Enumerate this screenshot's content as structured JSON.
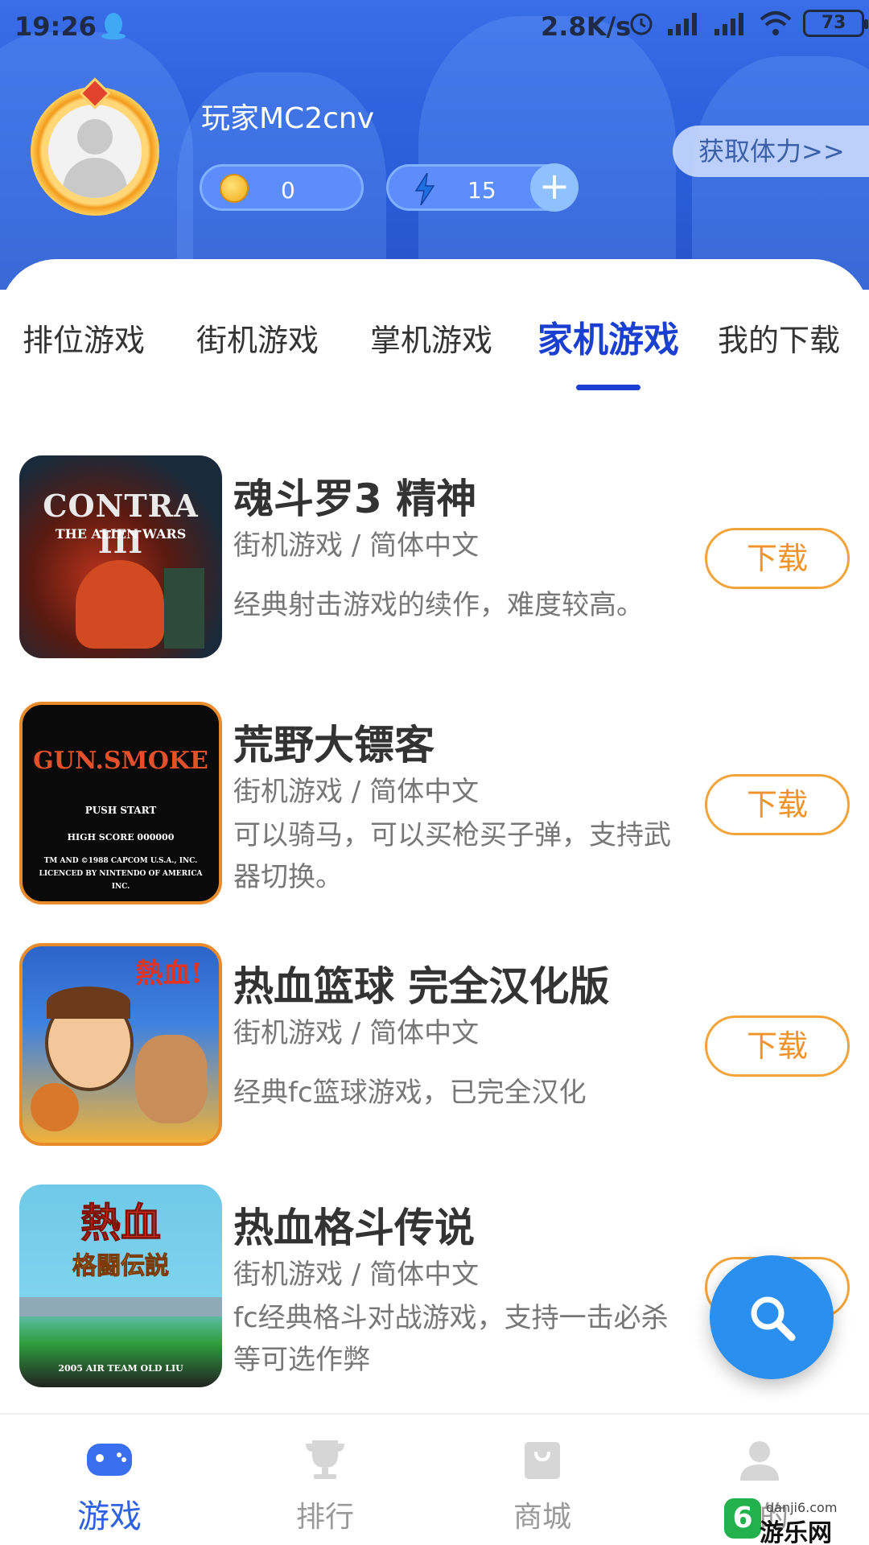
{
  "status_bar": {
    "time": "19:26",
    "speed": "2.8K/s",
    "battery": "73"
  },
  "profile": {
    "username": "玩家MC2cnv",
    "coins": "0",
    "energy": "15",
    "get_energy_label": "获取体力>>"
  },
  "tabs": [
    {
      "label": "排位游戏"
    },
    {
      "label": "街机游戏"
    },
    {
      "label": "掌机游戏"
    },
    {
      "label": "家机游戏",
      "active": true
    },
    {
      "label": "我的下载"
    }
  ],
  "games": [
    {
      "title": "魂斗罗3 精神",
      "meta": "街机游戏 / 简体中文",
      "desc": "经典射击游戏的续作，难度较高。",
      "download": "下载",
      "art_text": "CONTRA III",
      "art_sub": "THE ALIEN WARS"
    },
    {
      "title": "荒野大镖客",
      "meta": "街机游戏 / 简体中文",
      "desc": "可以骑马，可以买枪买子弹，支持武器切换。",
      "download": "下载",
      "art_text": "GUN.SMOKE",
      "art_sub": "PUSH START",
      "art_score": "HIGH SCORE  000000",
      "art_copy": "TM AND ©1988 CAPCOM U.S.A., INC. LICENCED BY NINTENDO OF AMERICA INC."
    },
    {
      "title": "热血篮球 完全汉化版",
      "meta": "街机游戏 / 简体中文",
      "desc": "经典fc篮球游戏，已完全汉化",
      "download": "下载",
      "art_text": "熱血!"
    },
    {
      "title": "热血格斗传说",
      "meta": "街机游戏 / 简体中文",
      "desc": "fc经典格斗对战游戏，支持一击必杀等可选作弊",
      "download": "下载",
      "art_text": "熱血",
      "art_sub": "格闘伝説",
      "art_foot": "2005 AIR TEAM OLD LIU"
    }
  ],
  "bottom_nav": [
    {
      "label": "游戏",
      "active": true
    },
    {
      "label": "排行"
    },
    {
      "label": "商城"
    },
    {
      "label": "我的"
    }
  ],
  "watermark": {
    "site": "danji6.com",
    "brand": "游乐网",
    "logo": "6"
  },
  "colors": {
    "primary": "#1b3fd1",
    "accent_orange": "#f0932b",
    "fab_blue": "#2b8ff0"
  }
}
